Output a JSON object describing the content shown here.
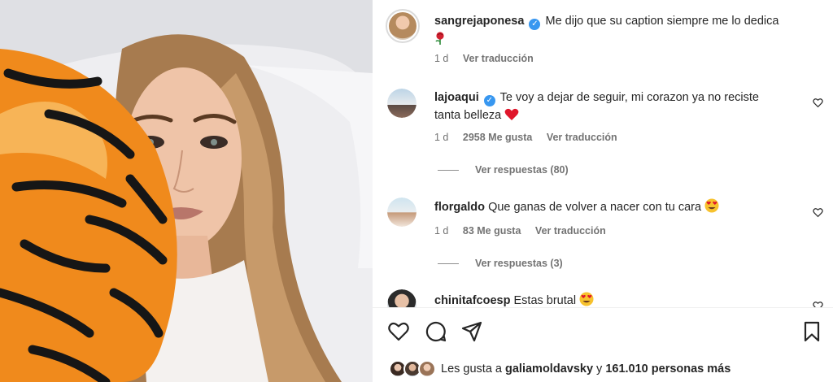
{
  "post": {
    "author": "sangrejaponesa",
    "caption": "Me dijo que su caption siempre me lo dedica",
    "caption_emoji": "rose",
    "age": "1 d",
    "translate_label": "Ver traducción"
  },
  "comments": [
    {
      "user": "lajoaqui",
      "verified": true,
      "text_line1": "Te voy a dejar de seguir, mi corazon ya no reciste",
      "text_line2": "tanta belleza",
      "emoji": "red-heart",
      "age": "1 d",
      "likes": "2958 Me gusta",
      "translate_label": "Ver traducción",
      "replies_label": "Ver respuestas (80)"
    },
    {
      "user": "florgaldo",
      "verified": false,
      "text_line1": "Que ganas de volver a nacer con tu cara",
      "emoji": "heart-eyes",
      "age": "1 d",
      "likes": "83 Me gusta",
      "translate_label": "Ver traducción",
      "replies_label": "Ver respuestas (3)"
    },
    {
      "user": "chinitafcoesp",
      "verified": false,
      "text_line1": "Estas brutal",
      "emoji": "heart-eyes"
    }
  ],
  "actions": {
    "icons": [
      "heart-icon",
      "comment-icon",
      "share-icon",
      "bookmark-icon"
    ]
  },
  "likes": {
    "prefix": "Les gusta a",
    "user": "galiamoldavsky",
    "joiner": "y",
    "count": "161.010 personas más"
  },
  "colors": {
    "verified": "#3897f0",
    "secondary_text": "#737373",
    "heart_red": "#ed1c3a",
    "emoji_yellow": "#f7c22e"
  }
}
